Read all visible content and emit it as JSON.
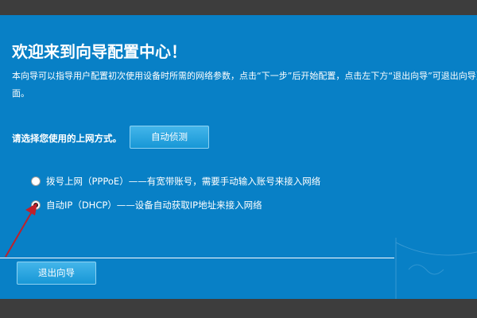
{
  "wizard": {
    "title": "欢迎来到向导配置中心！",
    "description": "本向导可以指导用户配置初次使用设备时所需的网络参数，点击“下一步”后开始配置，点击左下方“退出向导”可退出向导页面。",
    "method_label": "请选择您使用的上网方式。",
    "detect_button": "自动侦测",
    "options": [
      {
        "label": "拨号上网（PPPoE）——有宽带账号，需要手动输入账号来接入网络",
        "selected": false
      },
      {
        "label": "自动IP（DHCP）——设备自动获取IP地址来接入网络",
        "selected": true
      }
    ],
    "exit_button": "退出向导"
  },
  "colors": {
    "panel": "#0880c6",
    "frame": "#3d3d3d",
    "button": "#1797d6",
    "arrow": "#c0202a"
  }
}
